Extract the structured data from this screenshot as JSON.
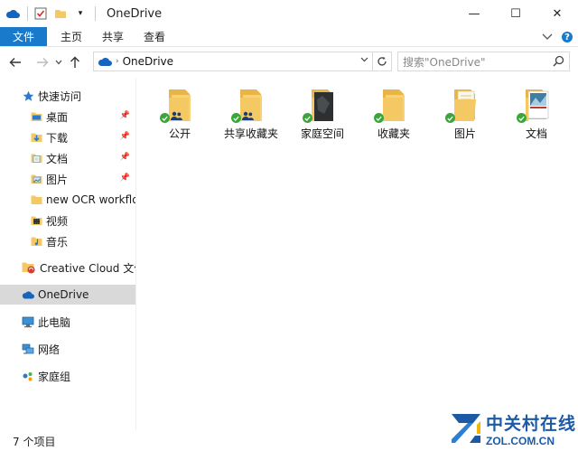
{
  "window": {
    "title": "OneDrive"
  },
  "window_controls": {
    "minimize": "—",
    "maximize": "☐",
    "close": "✕"
  },
  "ribbon": {
    "tabs": [
      {
        "label": "文件"
      },
      {
        "label": "主页"
      },
      {
        "label": "共享"
      },
      {
        "label": "查看"
      }
    ]
  },
  "address": {
    "path": "OneDrive"
  },
  "search": {
    "placeholder": "搜索\"OneDrive\""
  },
  "sidebar": {
    "items": [
      {
        "label": "快速访问",
        "icon": "star-icon"
      },
      {
        "label": "桌面",
        "icon": "desktop-folder-icon",
        "pinned": true
      },
      {
        "label": "下载",
        "icon": "downloads-folder-icon",
        "pinned": true
      },
      {
        "label": "文档",
        "icon": "documents-folder-icon",
        "pinned": true
      },
      {
        "label": "图片",
        "icon": "pictures-folder-icon",
        "pinned": true
      },
      {
        "label": "new OCR workflow",
        "icon": "folder-icon"
      },
      {
        "label": "视频",
        "icon": "videos-folder-icon"
      },
      {
        "label": "音乐",
        "icon": "music-folder-icon"
      },
      {
        "label": "Creative Cloud 文件",
        "icon": "creative-cloud-folder-icon"
      },
      {
        "label": "OneDrive",
        "icon": "onedrive-cloud-icon",
        "selected": true
      },
      {
        "label": "此电脑",
        "icon": "computer-icon"
      },
      {
        "label": "网络",
        "icon": "network-icon"
      },
      {
        "label": "家庭组",
        "icon": "homegroup-icon"
      }
    ]
  },
  "folders": [
    {
      "label": "公开",
      "shared": true,
      "thumb": "plain"
    },
    {
      "label": "共享收藏夹",
      "shared": true,
      "thumb": "plain"
    },
    {
      "label": "家庭空间",
      "shared": false,
      "thumb": "dark"
    },
    {
      "label": "收藏夹",
      "shared": false,
      "thumb": "plain"
    },
    {
      "label": "图片",
      "shared": false,
      "thumb": "papers"
    },
    {
      "label": "文档",
      "shared": false,
      "thumb": "cover"
    }
  ],
  "status": {
    "item_count": "7 个项目"
  },
  "watermark": {
    "cn": "中关村在线",
    "en": "ZOL.COM.CN"
  },
  "colors": {
    "accent": "#1979ca",
    "folder": "#f4c964",
    "selected": "#d9d9d9",
    "sync_ok": "#3aa63a"
  }
}
